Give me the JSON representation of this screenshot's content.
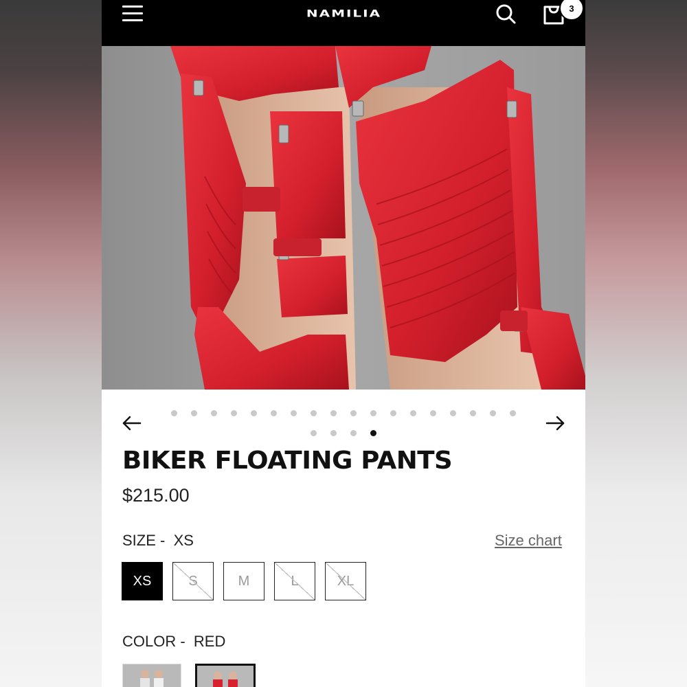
{
  "header": {
    "brand": "NAMILIA",
    "cart_count": "3"
  },
  "carousel": {
    "total_slides": 22,
    "active_slide": 22
  },
  "product": {
    "title": "BIKER FLOATING PANTS",
    "price": "$215.00"
  },
  "size": {
    "label_prefix": "SIZE -",
    "selected": "XS",
    "chart_link": "Size chart",
    "options": [
      {
        "label": "XS",
        "state": "selected"
      },
      {
        "label": "S",
        "state": "unavailable"
      },
      {
        "label": "M",
        "state": "available"
      },
      {
        "label": "L",
        "state": "unavailable"
      },
      {
        "label": "XL",
        "state": "unavailable"
      }
    ]
  },
  "color": {
    "label_prefix": "COLOR -",
    "selected": "RED",
    "swatch_count": 2,
    "selected_swatch": 2
  },
  "colors": {
    "header_bg": "#000000",
    "leather_red": "#d8202e",
    "accent": "#111111"
  }
}
